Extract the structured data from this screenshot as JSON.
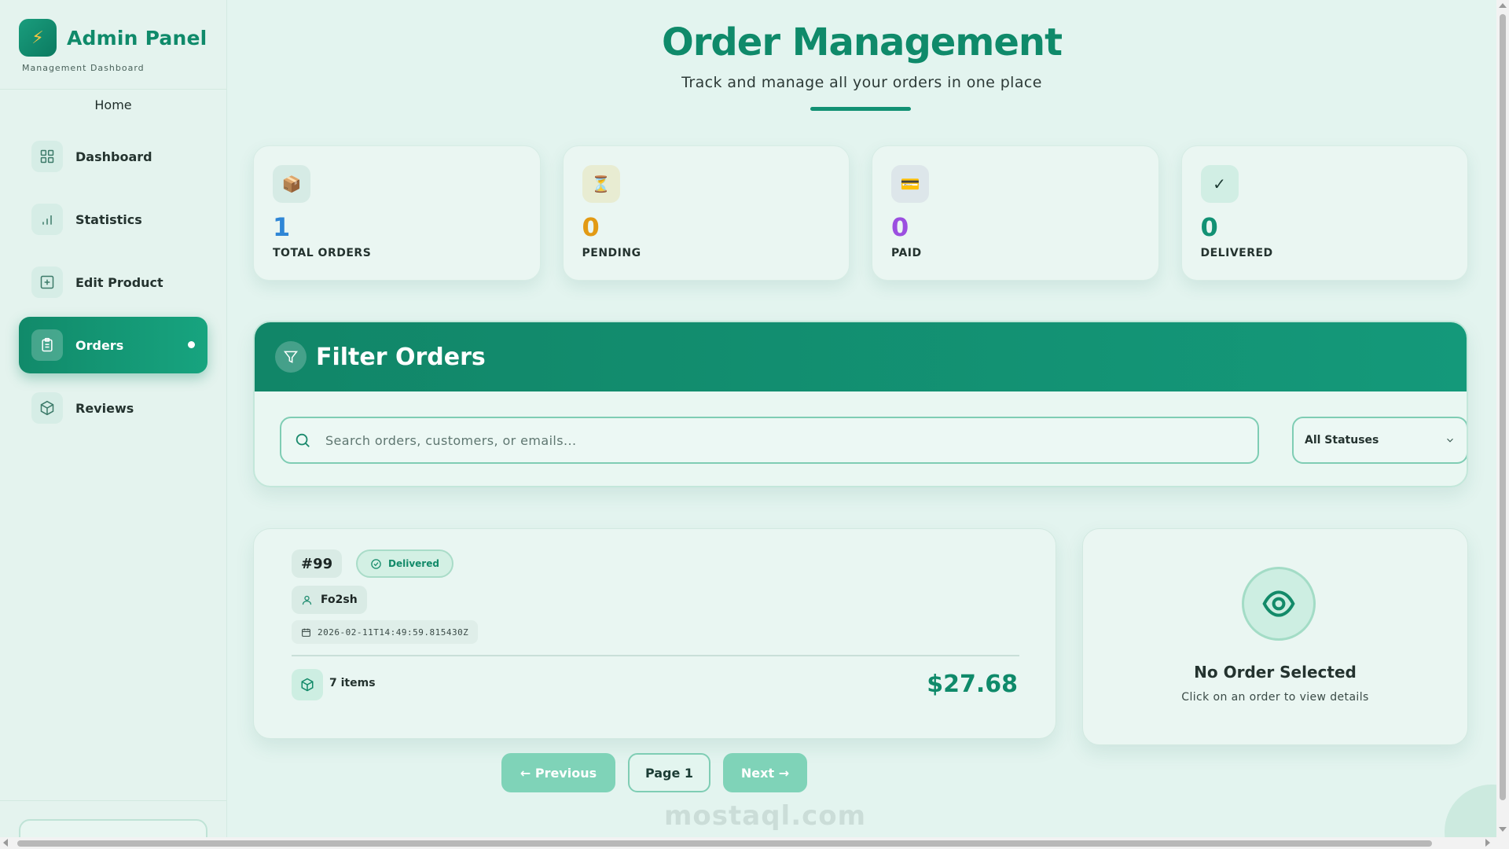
{
  "sidebar": {
    "brand_title": "Admin Panel",
    "brand_subtitle": "Management Dashboard",
    "home_label": "Home",
    "items": [
      {
        "label": "Dashboard",
        "icon": "grid-icon"
      },
      {
        "label": "Statistics",
        "icon": "bar-chart-icon"
      },
      {
        "label": "Edit Product",
        "icon": "plus-square-icon"
      },
      {
        "label": "Orders",
        "icon": "clipboard-icon",
        "active": true
      },
      {
        "label": "Reviews",
        "icon": "box-icon"
      }
    ]
  },
  "header": {
    "title": "Order Management",
    "subtitle": "Track and manage all your orders in one place"
  },
  "stats": [
    {
      "label": "TOTAL ORDERS",
      "value": "1",
      "icon": "📦",
      "color": "#2f86d6"
    },
    {
      "label": "PENDING",
      "value": "0",
      "icon": "⏳",
      "color": "#e29a14"
    },
    {
      "label": "PAID",
      "value": "0",
      "icon": "💳",
      "color": "#9b4fe0"
    },
    {
      "label": "DELIVERED",
      "value": "0",
      "icon": "✓",
      "color": "#129174"
    }
  ],
  "filter": {
    "title": "Filter Orders",
    "search_placeholder": "Search orders, customers, or emails...",
    "search_value": "",
    "status_selected": "All Statuses"
  },
  "order": {
    "id": "#99",
    "status": "Delivered",
    "customer": "Fo2sh",
    "date": "2026-02-11T14:49:59.815430Z",
    "items": "7 items",
    "total": "$27.68"
  },
  "detail": {
    "title": "No Order Selected",
    "subtitle": "Click on an order to view details"
  },
  "pagination": {
    "previous": "← Previous",
    "page": "Page 1",
    "next": "Next →"
  },
  "watermark": "mostaql.com",
  "colors": {
    "accent": "#0f8a6a",
    "background": "#e3f4ef"
  }
}
